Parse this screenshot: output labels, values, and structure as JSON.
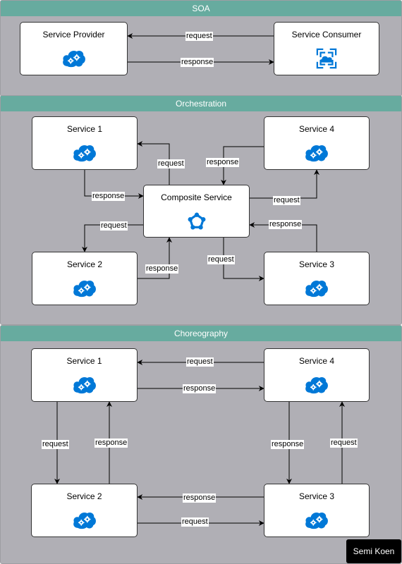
{
  "sections": {
    "soa": {
      "title": "SOA",
      "provider": "Service Provider",
      "consumer": "Service Consumer",
      "edges": {
        "request": "request",
        "response": "response"
      }
    },
    "orchestration": {
      "title": "Orchestration",
      "composite": "Composite Service",
      "service1": "Service 1",
      "service2": "Service 2",
      "service3": "Service 3",
      "service4": "Service 4",
      "edges": {
        "c_to_s1": "request",
        "s1_to_c": "response",
        "s4_to_c": "response",
        "c_to_s4": "request",
        "c_to_s2": "request",
        "s2_to_c": "response",
        "s3_to_c": "response",
        "c_to_s3": "request"
      }
    },
    "choreography": {
      "title": "Choreography",
      "service1": "Service 1",
      "service2": "Service 2",
      "service3": "Service 3",
      "service4": "Service 4",
      "edges": {
        "s4_to_s1": "request",
        "s1_to_s4": "response",
        "s1_to_s2": "request",
        "s2_to_s1": "response",
        "s4_to_s3": "response",
        "s3_to_s4": "request",
        "s3_to_s2": "response",
        "s2_to_s3": "request"
      }
    }
  },
  "icons": {
    "service": "cloud-gears-icon",
    "consumer": "cloud-app-icon",
    "composite": "network-pentagon-icon"
  },
  "colors": {
    "header": "#67ab9f",
    "panel": "#b0afb5",
    "icon": "#0078d7"
  },
  "author_badge": "Semi Koen"
}
